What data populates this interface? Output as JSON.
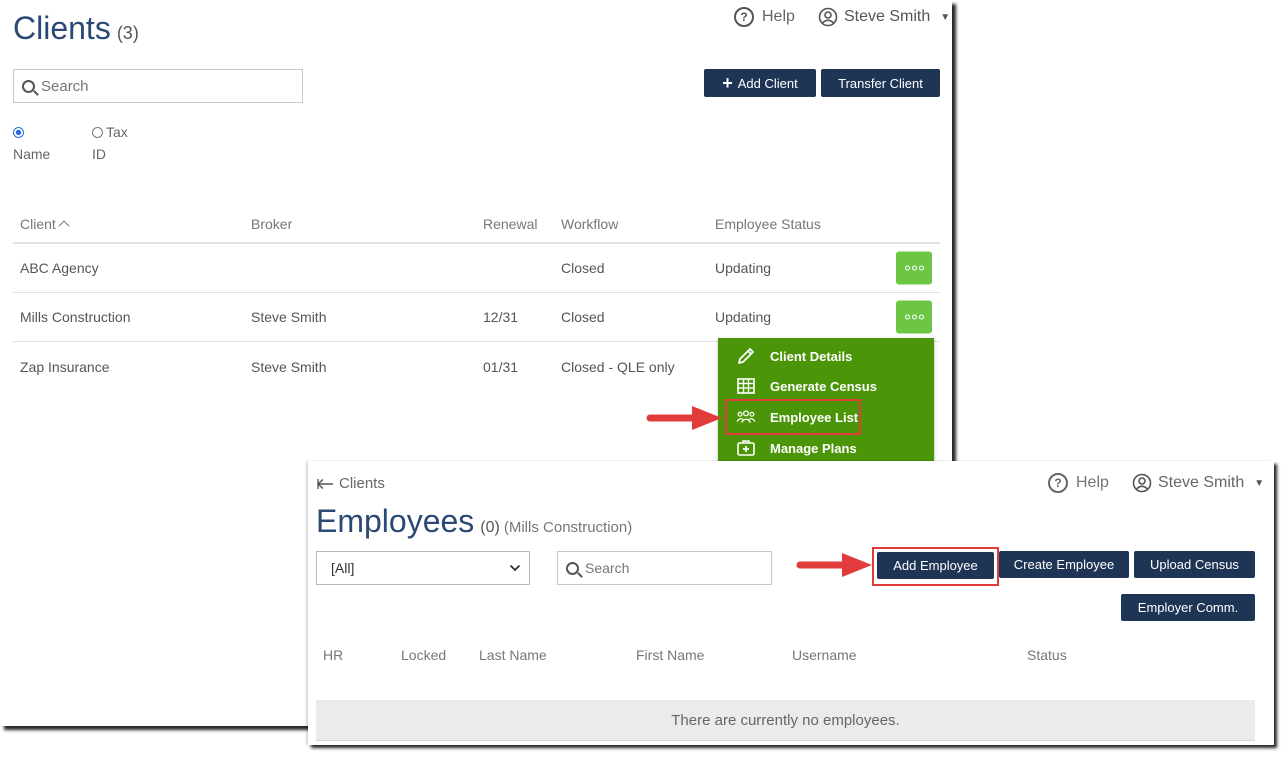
{
  "clients_page": {
    "title": "Clients",
    "count": "(3)",
    "help_label": "Help",
    "user_name": "Steve Smith",
    "search_placeholder": "Search",
    "add_client_label": "Add Client",
    "transfer_client_label": "Transfer Client",
    "search_by": [
      {
        "line1": "",
        "line2": "Name",
        "selected": true
      },
      {
        "line1": "Tax",
        "line2": "ID",
        "selected": false
      }
    ],
    "table": {
      "headers": [
        "Client",
        "Broker",
        "Renewal",
        "Workflow",
        "Employee Status"
      ],
      "sort_indicator": "^",
      "rows": [
        {
          "client": "ABC Agency",
          "broker": "",
          "renewal": "",
          "workflow": "Closed",
          "status": "Updating"
        },
        {
          "client": "Mills Construction",
          "broker": "Steve Smith",
          "renewal": "12/31",
          "workflow": "Closed",
          "status": "Updating"
        },
        {
          "client": "Zap Insurance",
          "broker": "Steve Smith",
          "renewal": "01/31",
          "workflow": "Closed - QLE only",
          "status": ""
        }
      ]
    },
    "row_menu": {
      "items": [
        {
          "label": "Client Details",
          "icon": "pencil-icon"
        },
        {
          "label": "Generate Census",
          "icon": "grid-icon"
        },
        {
          "label": "Employee List",
          "icon": "people-icon"
        },
        {
          "label": "Manage Plans",
          "icon": "medical-bag-icon"
        }
      ]
    }
  },
  "employees_page": {
    "back_label": "Clients",
    "title": "Employees",
    "count": "(0)",
    "subtitle": "(Mills Construction)",
    "help_label": "Help",
    "user_name": "Steve Smith",
    "filter_value": "[All]",
    "search_placeholder": "Search",
    "buttons": {
      "add_employee": "Add Employee",
      "create_employee": "Create Employee",
      "upload_census": "Upload Census",
      "employer_comm": "Employer Comm."
    },
    "table_headers": [
      "HR",
      "Locked",
      "Last Name",
      "First Name",
      "Username",
      "Status"
    ],
    "empty_message": "There are currently no employees."
  },
  "colors": {
    "navy": "#1f3556",
    "title_blue": "#2a4a75",
    "menu_green": "#4a9608",
    "more_green": "#6cc644",
    "highlight_red": "#e23b3b"
  }
}
